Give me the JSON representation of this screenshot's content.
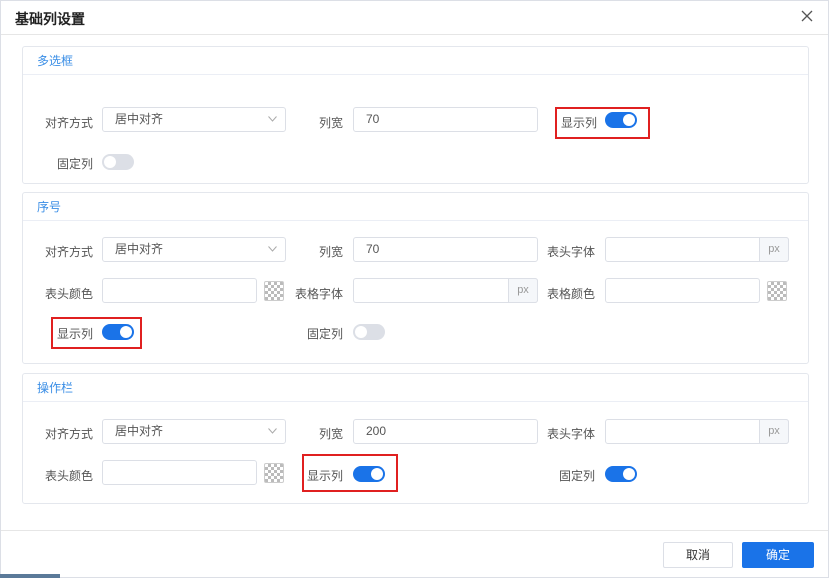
{
  "dialog": {
    "title": "基础列设置"
  },
  "groups": [
    {
      "title": "多选框",
      "align_label": "对齐方式",
      "align_value": "居中对齐",
      "width_label": "列宽",
      "width_value": "70",
      "show_label": "显示列",
      "show_on": true,
      "fixed_label": "固定列",
      "fixed_on": false
    },
    {
      "title": "序号",
      "align_label": "对齐方式",
      "align_value": "居中对齐",
      "width_label": "列宽",
      "width_value": "70",
      "header_font_label": "表头字体",
      "header_font_value": "",
      "header_font_unit": "px",
      "header_color_label": "表头颜色",
      "header_color_value": "",
      "cell_font_label": "表格字体",
      "cell_font_value": "",
      "cell_font_unit": "px",
      "cell_color_label": "表格颜色",
      "cell_color_value": "",
      "show_label": "显示列",
      "show_on": true,
      "fixed_label": "固定列",
      "fixed_on": false
    },
    {
      "title": "操作栏",
      "align_label": "对齐方式",
      "align_value": "居中对齐",
      "width_label": "列宽",
      "width_value": "200",
      "header_font_label": "表头字体",
      "header_font_value": "",
      "header_font_unit": "px",
      "header_color_label": "表头颜色",
      "header_color_value": "",
      "show_label": "显示列",
      "show_on": true,
      "fixed_label": "固定列",
      "fixed_on": true
    }
  ],
  "footer": {
    "cancel_label": "取消",
    "ok_label": "确定"
  },
  "icons": {
    "close": "close-icon",
    "dropdown": "chevron-down-icon",
    "color_picker": "color-picker-icon"
  },
  "colors": {
    "accent": "#1a73e8",
    "group_title": "#3a8ee6",
    "highlight": "#e02020",
    "toggle_off": "#dcdfe6"
  }
}
